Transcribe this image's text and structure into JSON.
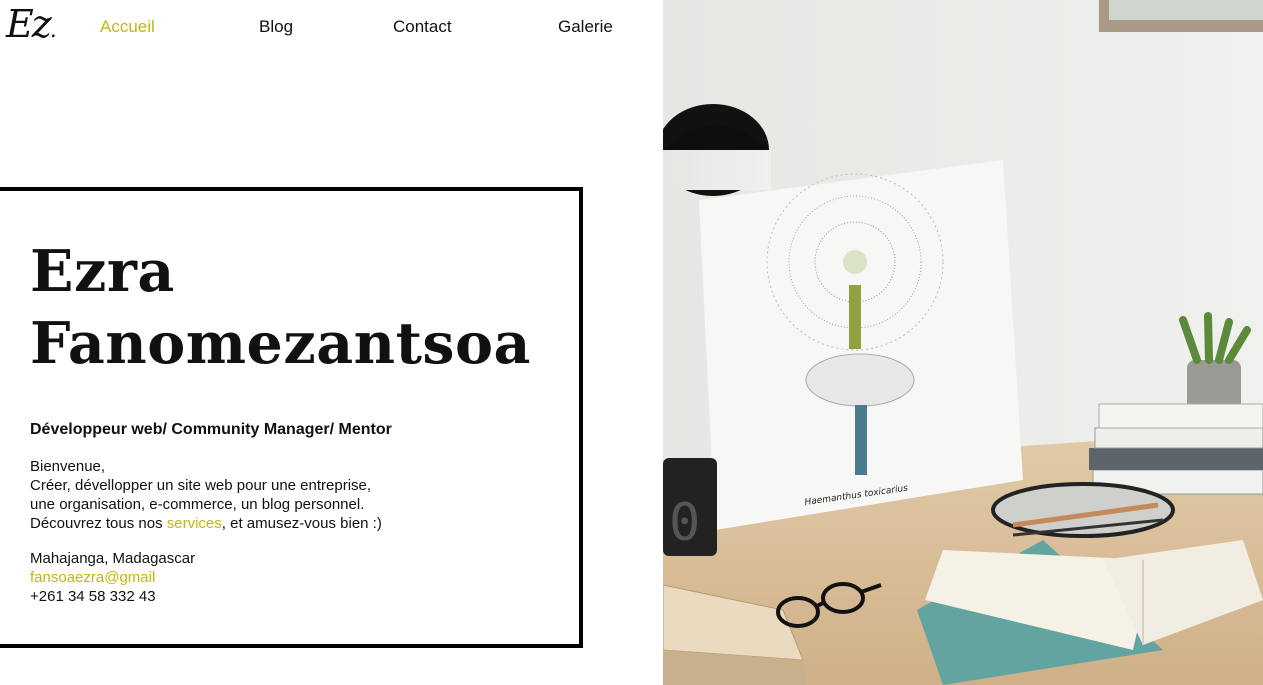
{
  "logo": "Ez",
  "nav": [
    {
      "label": "Accueil",
      "active": true
    },
    {
      "label": "Blog",
      "active": false
    },
    {
      "label": "Contact",
      "active": false
    },
    {
      "label": "Galerie",
      "active": false
    }
  ],
  "hero": {
    "name_line1": "Ezra",
    "name_line2": "Fanomezantsoa",
    "role": "Développeur web/ Community Manager/ Mentor",
    "greeting": "Bienvenue,",
    "line1": "Créer, dévellopper un site web pour une entreprise,",
    "line2": "une organisation, e-commerce, un blog personnel.",
    "line3_before": "Découvrez tous nos ",
    "line3_link": "services",
    "line3_after": ", et amusez-vous bien :)",
    "location": "Mahajanga, Madagascar",
    "email": "fansoaezra@gmail",
    "phone": "+261 34 58 332 43"
  },
  "photo": {
    "poster_caption": "Haemanthus toxicarius",
    "clock_digit": "0"
  },
  "colors": {
    "accent": "#c2b712",
    "text": "#111111",
    "wall": "#ececea",
    "desk": "#d9bf9a"
  }
}
